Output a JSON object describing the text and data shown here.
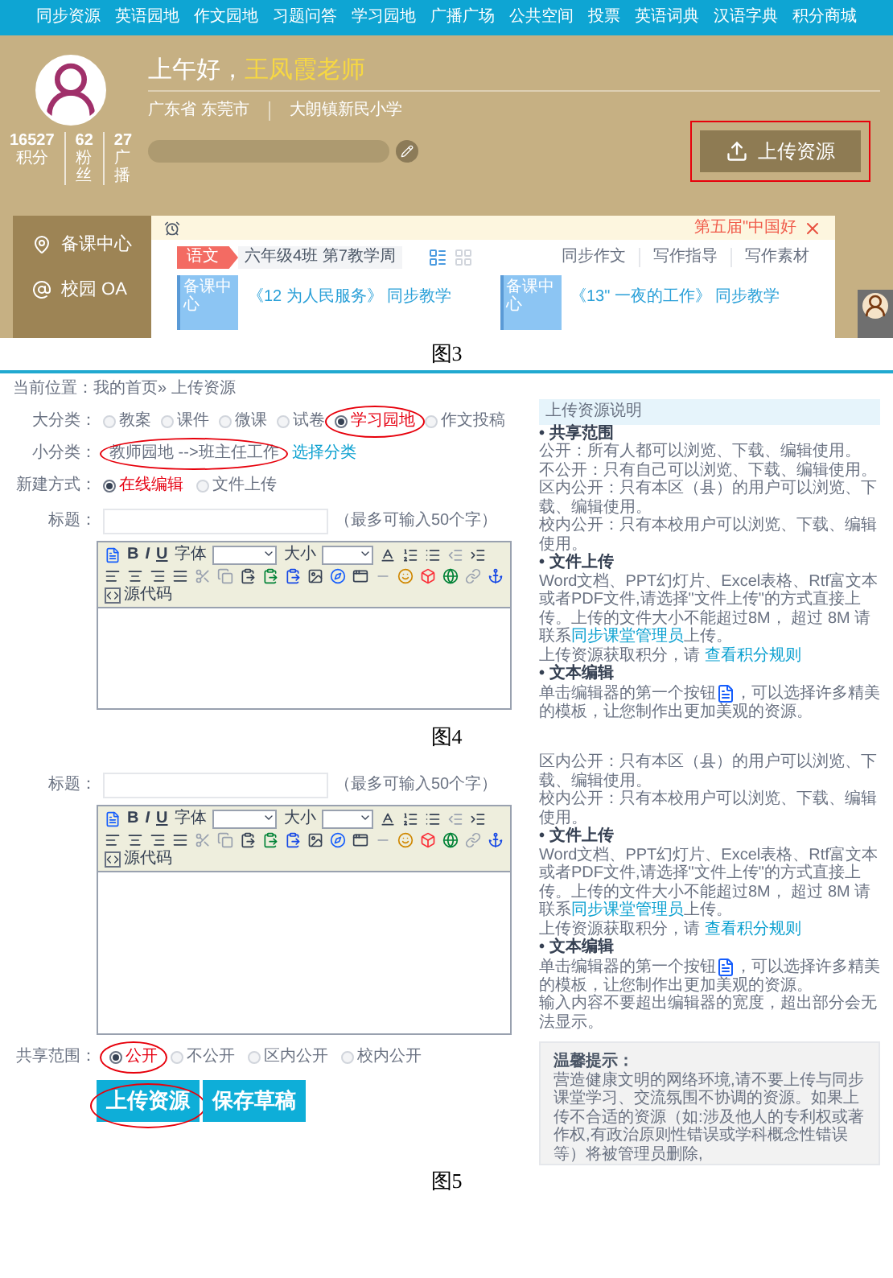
{
  "figure3": {
    "caption": "图3",
    "nav": [
      "同步资源",
      "英语园地",
      "作文园地",
      "习题问答",
      "学习园地",
      "广播广场",
      "公共空间",
      "投票",
      "英语词典",
      "汉语字典",
      "积分商城"
    ],
    "greeting": "上午好，",
    "name": "王凤霞老师",
    "location": "广东省 东莞市",
    "school": "大朗镇新民小学",
    "stats": [
      {
        "value": "16527",
        "label": "积分"
      },
      {
        "value": "62",
        "label": "粉丝"
      },
      {
        "value": "27",
        "label": "广播"
      }
    ],
    "upload_button": {
      "label": "上传资源",
      "boxed": true
    },
    "sidebar": [
      {
        "kind": "pin",
        "label": "备课中心"
      },
      {
        "kind": "at",
        "label": "校园 OA"
      }
    ],
    "notice": "第五届\"中国好",
    "subject_tab": "语文",
    "week": "六年级4班 第7教学周",
    "views": [
      {
        "kind": "list",
        "selected": true
      },
      {
        "kind": "grid",
        "selected": false
      }
    ],
    "links": [
      "同步作文",
      "写作指导",
      "写作素材"
    ],
    "cards": [
      {
        "thumb": "备课中心",
        "title": "《12 为人民服务》 同步教学"
      },
      {
        "thumb": "备课中心",
        "title": "《13\" 一夜的工作》 同步教学"
      }
    ]
  },
  "figure4": {
    "caption": "图4",
    "breadcrumb": "当前位置：我的首页» 上传资源",
    "category": {
      "label": "大分类：",
      "options": [
        {
          "label": "教案",
          "selected": false,
          "circled": false
        },
        {
          "label": "课件",
          "selected": false,
          "circled": false
        },
        {
          "label": "微课",
          "selected": false,
          "circled": false
        },
        {
          "label": "试卷",
          "selected": false,
          "circled": false
        },
        {
          "label": "学习园地",
          "selected": true,
          "circled": true
        },
        {
          "label": "作文投稿",
          "selected": false,
          "circled": false
        }
      ]
    },
    "subcategory": {
      "label": "小分类：",
      "value": "教师园地 -->班主任工作",
      "circled": true,
      "link": "选择分类"
    },
    "mode": {
      "label": "新建方式：",
      "options": [
        {
          "label": "在线编辑",
          "selected": true,
          "circled": false
        },
        {
          "label": "文件上传",
          "selected": false,
          "circled": false
        }
      ]
    },
    "title_field": {
      "label": "标题：",
      "hint": "（最多可输入50个字）"
    },
    "editor": {
      "bold": "B",
      "italic": "I",
      "underline": "U",
      "font_label": "字体",
      "size_label": "大小",
      "source_label": "源代码"
    },
    "panel": {
      "title": "上传资源说明",
      "paragraphs": [
        {
          "kind": "heading",
          "parts": [
            {
              "kind": "text",
              "text": "• 共享范围"
            }
          ]
        },
        {
          "kind": "text",
          "parts": [
            {
              "kind": "text",
              "text": "公开：所有人都可以浏览、下载、编辑使用。"
            }
          ]
        },
        {
          "kind": "text",
          "parts": [
            {
              "kind": "text",
              "text": "不公开：只有自己可以浏览、下载、编辑使用。"
            }
          ]
        },
        {
          "kind": "text",
          "parts": [
            {
              "kind": "text",
              "text": "区内公开：只有本区（县）的用户可以浏览、下载、编辑使用。"
            }
          ]
        },
        {
          "kind": "text",
          "parts": [
            {
              "kind": "text",
              "text": "校内公开：只有本校用户可以浏览、下载、编辑使用。"
            }
          ]
        },
        {
          "kind": "heading",
          "parts": [
            {
              "kind": "text",
              "text": "• 文件上传"
            }
          ]
        },
        {
          "kind": "text",
          "parts": [
            {
              "kind": "text",
              "text": "Word文档、PPT幻灯片、Excel表格、Rtf富文本或者PDF文件,请选择\"文件上传\"的方式直接上传。上传的文件大小不能超过8M， 超过 8M 请联系"
            },
            {
              "kind": "link",
              "text": "同步课堂管理员"
            },
            {
              "kind": "text",
              "text": "上传。"
            }
          ]
        },
        {
          "kind": "text",
          "parts": [
            {
              "kind": "text",
              "text": "上传资源获取积分，请 "
            },
            {
              "kind": "link",
              "text": "查看积分规则"
            }
          ]
        },
        {
          "kind": "heading",
          "parts": [
            {
              "kind": "text",
              "text": "• 文本编辑"
            }
          ]
        },
        {
          "kind": "text",
          "parts": [
            {
              "kind": "text",
              "text": "单击编辑器的第一个按钮"
            },
            {
              "kind": "icon"
            },
            {
              "kind": "text",
              "text": "，可以选择许多精美的模板，让您制作出更加美观的资源。"
            }
          ]
        }
      ]
    }
  },
  "figure5": {
    "caption": "图5",
    "title_field": {
      "label": "标题：",
      "hint": "（最多可输入50个字）"
    },
    "editor": {
      "bold": "B",
      "italic": "I",
      "underline": "U",
      "font_label": "字体",
      "size_label": "大小",
      "source_label": "源代码"
    },
    "share": {
      "label": "共享范围：",
      "options": [
        {
          "label": "公开",
          "selected": true,
          "circled": true
        },
        {
          "label": "不公开",
          "selected": false,
          "circled": false
        },
        {
          "label": "区内公开",
          "selected": false,
          "circled": false
        },
        {
          "label": "校内公开",
          "selected": false,
          "circled": false
        }
      ]
    },
    "buttons": [
      {
        "label": "上传资源",
        "circled": true
      },
      {
        "label": "保存草稿",
        "circled": false
      }
    ],
    "panel": {
      "paragraphs": [
        {
          "kind": "text",
          "parts": [
            {
              "kind": "text",
              "text": "区内公开：只有本区（县）的用户可以浏览、下载、编辑使用。"
            }
          ]
        },
        {
          "kind": "text",
          "parts": [
            {
              "kind": "text",
              "text": "校内公开：只有本校用户可以浏览、下载、编辑使用。"
            }
          ]
        },
        {
          "kind": "heading",
          "parts": [
            {
              "kind": "text",
              "text": "• 文件上传"
            }
          ]
        },
        {
          "kind": "text",
          "parts": [
            {
              "kind": "text",
              "text": "Word文档、PPT幻灯片、Excel表格、Rtf富文本或者PDF文件,请选择\"文件上传\"的方式直接上传。上传的文件大小不能超过8M， 超过 8M 请联系"
            },
            {
              "kind": "link",
              "text": "同步课堂管理员"
            },
            {
              "kind": "text",
              "text": "上传。"
            }
          ]
        },
        {
          "kind": "text",
          "parts": [
            {
              "kind": "text",
              "text": "上传资源获取积分，请 "
            },
            {
              "kind": "link",
              "text": "查看积分规则"
            }
          ]
        },
        {
          "kind": "heading",
          "parts": [
            {
              "kind": "text",
              "text": "• 文本编辑"
            }
          ]
        },
        {
          "kind": "text",
          "parts": [
            {
              "kind": "text",
              "text": "单击编辑器的第一个按钮"
            },
            {
              "kind": "icon"
            },
            {
              "kind": "text",
              "text": "，可以选择许多精美的模板，让您制作出更加美观的资源。"
            }
          ]
        },
        {
          "kind": "text",
          "parts": [
            {
              "kind": "text",
              "text": "输入内容不要超出编辑器的宽度，超出部分会无法显示。"
            }
          ]
        }
      ],
      "tip": {
        "title": "温馨提示：",
        "text": "营造健康文明的网络环境,请不要上传与同步课堂学习、交流氛围不协调的资源。如果上传不合适的资源（如:涉及他人的专利权或著作权,有政治原则性错误或学科概念性错误等）将被管理员删除,"
      }
    }
  }
}
